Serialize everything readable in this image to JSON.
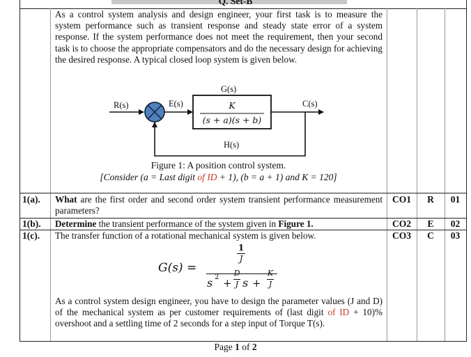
{
  "document": {
    "header_title": "Q. Set-B",
    "intro_paragraph": "As a control system analysis and design engineer, your first task is to measure the system performance such as transient response and steady state error of a system response. If the system performance does not meet the requirement, then your second task is to choose the appropriate compensators and do the necessary design for achieving the desired response. A typical closed loop system is given below.",
    "figure": {
      "labels": {
        "input": "R(s)",
        "error": "E(s)",
        "forward_block": "G(s)",
        "output": "C(s)",
        "feedback": "H(s)"
      },
      "transfer_numerator": "K",
      "transfer_denominator": "(s + a)(s + b)",
      "colors": {
        "summing_junction": "#4f81bd",
        "lines": "#111111"
      },
      "caption": "Figure 1: A position control system.",
      "condition": {
        "prefix": "[Consider (a = Last digit ",
        "highlight": "of ID",
        "suffix": " + 1), (b = a + 1) and K = 120]",
        "highlight_color": "#c0392b"
      }
    },
    "questions": [
      {
        "number": "1(a).",
        "bold_lead": "What",
        "text": " are the first order and second order system transient performance measurement parameters?",
        "co": "CO1",
        "level": "R",
        "marks": "01"
      },
      {
        "number": "1(b).",
        "bold_lead": "Determine",
        "text": " the transient performance of the system given in ",
        "bold_tail": "Figure 1.",
        "co": "CO2",
        "level": "E",
        "marks": "02"
      },
      {
        "number": "1(c).",
        "text": "The transfer function of a rotational mechanical system is given below.",
        "co": "CO3",
        "level": "C",
        "marks": "03",
        "equation": {
          "lhs": "G(s) =",
          "num_num": "1",
          "num_den": "J",
          "den_s2": "s",
          "den_sup": "2",
          "plus1": "+",
          "frac1_num": "D",
          "frac1_den": "J",
          "den_s": "s",
          "plus2": "+",
          "frac2_num": "K",
          "frac2_den": "J"
        },
        "followup_part1": "As a control system design engineer, you have to design the parameter values (J and D) of the mechanical system as per customer requirements of (last digit ",
        "followup_highlight": "of ID",
        "followup_part2": " + 10)% overshoot and a settling time of 2 seconds for a step input of Torque T(s)."
      }
    ],
    "footer": {
      "prefix": "Page ",
      "current": "1",
      "middle": " of ",
      "total": "2"
    }
  }
}
